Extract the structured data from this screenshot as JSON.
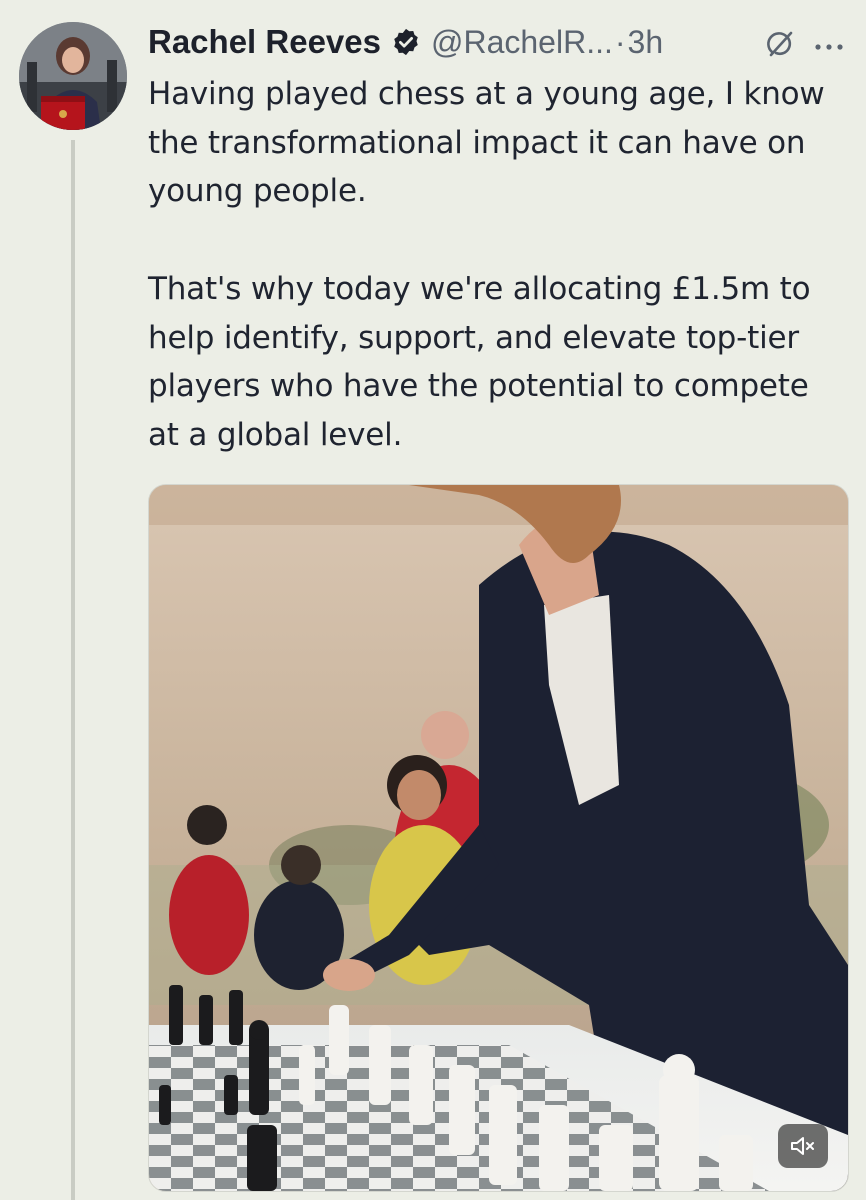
{
  "tweet": {
    "author_name": "Rachel Reeves",
    "handle": "@RachelR...",
    "separator": "·",
    "time": "3h",
    "paragraphs": [
      "Having played chess at a young age, I know the transformational impact it can have on young people.",
      "That's why today we're allocating £1.5m to help identify, support, and elevate top-tier players who have the potential to compete at a global level."
    ]
  },
  "icons": {
    "verified": "verified-badge-icon",
    "grok": "grok-icon",
    "more": "more-options-icon",
    "mute": "muted-speaker-icon"
  },
  "colors": {
    "background": "#eceee6",
    "text": "#1f2430",
    "secondary_text": "#5b6470",
    "verified_badge": "#1d212b",
    "thread_line": "#c9ccc4"
  }
}
